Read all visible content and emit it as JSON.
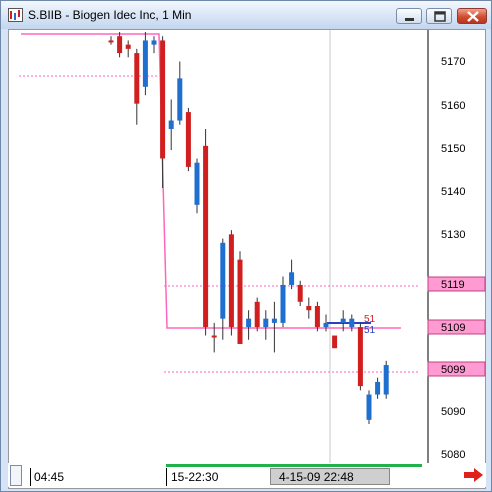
{
  "window": {
    "title": "S.BIIB - Biogen Idec Inc, 1 Min"
  },
  "chart": {
    "price_labels": [
      "5170",
      "5160",
      "5150",
      "5140",
      "5130",
      "5090",
      "5080"
    ],
    "badges": [
      "5119",
      "5109",
      "5099"
    ],
    "markers": [
      "51",
      "51"
    ],
    "colors": {
      "up": "#1f6fd1",
      "down": "#d11f1f",
      "level": "#ff66bb",
      "badge": "#ff9ad2"
    }
  },
  "time_axis": {
    "start": "04:45",
    "mid": "15-22:30",
    "cursor": "4-15-09  22:48"
  },
  "chart_data": {
    "type": "candlestick",
    "ylim": [
      5076,
      5178
    ],
    "yticks": [
      5170,
      5160,
      5150,
      5140,
      5130,
      5090,
      5080
    ],
    "levels": [
      5119,
      5109,
      5099
    ],
    "candles": [
      {
        "dir": "down",
        "o": 5176,
        "c": 5176,
        "h": 5177,
        "l": 5175
      },
      {
        "dir": "down",
        "o": 5177,
        "c": 5173,
        "h": 5178,
        "l": 5172
      },
      {
        "dir": "down",
        "o": 5175,
        "c": 5174,
        "h": 5176,
        "l": 5172
      },
      {
        "dir": "down",
        "o": 5173,
        "c": 5161,
        "h": 5174,
        "l": 5156
      },
      {
        "dir": "up",
        "o": 5165,
        "c": 5176,
        "h": 5178,
        "l": 5163
      },
      {
        "dir": "up",
        "o": 5175,
        "c": 5176,
        "h": 5177,
        "l": 5173
      },
      {
        "dir": "down",
        "o": 5176,
        "c": 5148,
        "h": 5177,
        "l": 5141
      },
      {
        "dir": "up",
        "o": 5155,
        "c": 5157,
        "h": 5162,
        "l": 5150
      },
      {
        "dir": "up",
        "o": 5157,
        "c": 5167,
        "h": 5171,
        "l": 5156
      },
      {
        "dir": "down",
        "o": 5159,
        "c": 5146,
        "h": 5160,
        "l": 5145
      },
      {
        "dir": "up",
        "o": 5137,
        "c": 5147,
        "h": 5148,
        "l": 5135
      },
      {
        "dir": "down",
        "o": 5151,
        "c": 5108,
        "h": 5155,
        "l": 5106
      },
      {
        "dir": "down",
        "o": 5106,
        "c": 5106,
        "h": 5109,
        "l": 5102
      },
      {
        "dir": "up",
        "o": 5110,
        "c": 5128,
        "h": 5129,
        "l": 5105
      },
      {
        "dir": "down",
        "o": 5130,
        "c": 5108,
        "h": 5131,
        "l": 5106
      },
      {
        "dir": "down",
        "o": 5124,
        "c": 5104,
        "h": 5126,
        "l": 5104
      },
      {
        "dir": "up",
        "o": 5108,
        "c": 5110,
        "h": 5112,
        "l": 5105
      },
      {
        "dir": "down",
        "o": 5114,
        "c": 5108,
        "h": 5115,
        "l": 5107
      },
      {
        "dir": "up",
        "o": 5108,
        "c": 5110,
        "h": 5112,
        "l": 5105
      },
      {
        "dir": "up",
        "o": 5109,
        "c": 5110,
        "h": 5114,
        "l": 5102
      },
      {
        "dir": "up",
        "o": 5109,
        "c": 5118,
        "h": 5120,
        "l": 5108
      },
      {
        "dir": "up",
        "o": 5118,
        "c": 5121,
        "h": 5124,
        "l": 5117
      },
      {
        "dir": "down",
        "o": 5118,
        "c": 5114,
        "h": 5119,
        "l": 5113
      },
      {
        "dir": "down",
        "o": 5113,
        "c": 5112,
        "h": 5115,
        "l": 5110
      },
      {
        "dir": "down",
        "o": 5113,
        "c": 5108,
        "h": 5114,
        "l": 5107
      },
      {
        "dir": "up",
        "o": 5108,
        "c": 5109,
        "h": 5111,
        "l": 5107
      },
      {
        "dir": "down",
        "o": 5106,
        "c": 5103,
        "h": 5106,
        "l": 5103
      },
      {
        "dir": "up",
        "o": 5109,
        "c": 5110,
        "h": 5112,
        "l": 5107
      },
      {
        "dir": "up",
        "o": 5108,
        "c": 5110,
        "h": 5111,
        "l": 5107
      },
      {
        "dir": "down",
        "o": 5108,
        "c": 5094,
        "h": 5109,
        "l": 5093
      },
      {
        "dir": "up",
        "o": 5086,
        "c": 5092,
        "h": 5093,
        "l": 5085
      },
      {
        "dir": "up",
        "o": 5092,
        "c": 5095,
        "h": 5096,
        "l": 5091
      },
      {
        "dir": "up",
        "o": 5092,
        "c": 5099,
        "h": 5100,
        "l": 5091
      }
    ]
  }
}
